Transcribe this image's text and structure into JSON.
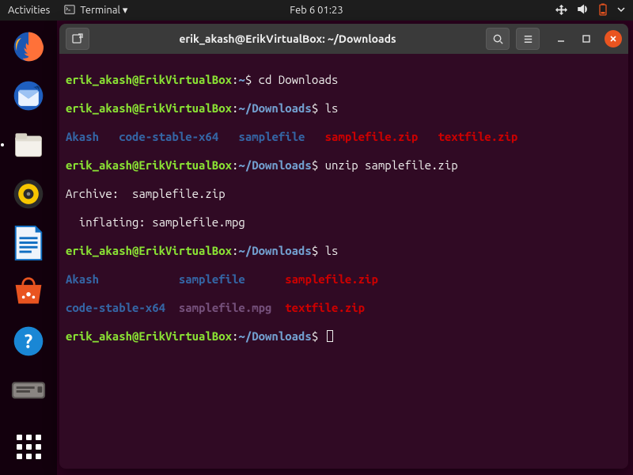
{
  "panel": {
    "activities": "Activities",
    "app_menu": "Terminal ▾",
    "clock": "Feb 6  01:23"
  },
  "dock": {
    "items": [
      {
        "name": "firefox"
      },
      {
        "name": "thunderbird"
      },
      {
        "name": "files",
        "active": true
      },
      {
        "name": "rhythmbox"
      },
      {
        "name": "libreoffice-writer"
      },
      {
        "name": "ubuntu-software"
      },
      {
        "name": "help"
      },
      {
        "name": "disk-utility"
      }
    ]
  },
  "window": {
    "title": "erik_akash@ErikVirtualBox: ~/Downloads"
  },
  "colors": {
    "user": "#8ae234",
    "path": "#729fcf",
    "text": "#eeeeec",
    "dir": "#3465a4",
    "zip": "#cc0000",
    "media": "#75507b",
    "bg": "#300a24",
    "accent": "#e95420"
  },
  "term": {
    "user": "erik_akash@ErikVirtualBox",
    "home_path": "~",
    "dl_path": "~/Downloads",
    "prompt_sep": ":",
    "prompt_char": "$",
    "cmd_cd": " cd Downloads",
    "cmd_ls": " ls",
    "cmd_unzip": " unzip samplefile.zip",
    "archive_line": "Archive:  samplefile.zip",
    "inflate_line": "  inflating: samplefile.mpg",
    "ls1": {
      "akash": "Akash",
      "pad1": "   ",
      "codex64": "code-stable-x64",
      "pad2": "   ",
      "samplefile": "samplefile",
      "pad3": "   ",
      "samplezip": "samplefile.zip",
      "pad4": "   ",
      "textzip": "textfile.zip"
    },
    "ls2": {
      "r1_akash": "Akash",
      "r1_pad1": "            ",
      "r1_samplefile": "samplefile",
      "r1_pad2": "      ",
      "r1_samplezip": "samplefile.zip",
      "r2_codex64": "code-stable-x64",
      "r2_pad1": "  ",
      "r2_samplempg": "samplefile.mpg",
      "r2_pad2": "  ",
      "r2_textzip": "textfile.zip"
    }
  }
}
